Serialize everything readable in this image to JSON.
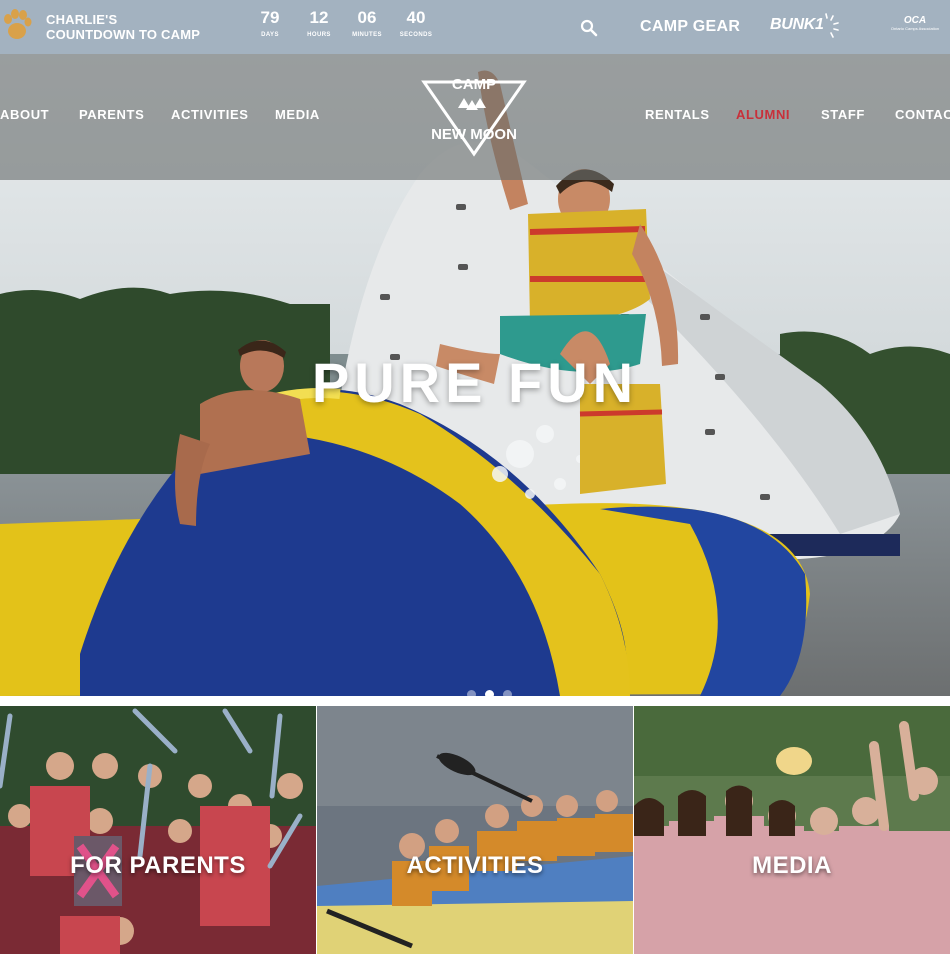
{
  "topbar": {
    "countdown_label_line1": "CHARLIE'S",
    "countdown_label_line2": "COUNTDOWN TO CAMP",
    "countdown": [
      {
        "value": "79",
        "unit": "DAYS"
      },
      {
        "value": "12",
        "unit": "HOURS"
      },
      {
        "value": "06",
        "unit": "MINUTES"
      },
      {
        "value": "40",
        "unit": "SECONDS"
      }
    ],
    "search_icon": "search-icon",
    "camp_gear": "CAMP GEAR",
    "bunk1": "BUNK1",
    "oca_logo": "OCA",
    "oca_sub": "Ontario Camps Association"
  },
  "nav": {
    "left": [
      "ABOUT",
      "PARENTS",
      "ACTIVITIES",
      "MEDIA"
    ],
    "right": [
      "RENTALS",
      "ALUMNI",
      "STAFF",
      "CONTACT"
    ],
    "active": "ALUMNI",
    "logo_line1": "CAMP",
    "logo_line2": "NEW MOON"
  },
  "hero": {
    "title": "PURE FUN",
    "slide_count": 3,
    "active_slide": 2
  },
  "tiles": [
    {
      "label": "FOR PARENTS"
    },
    {
      "label": "ACTIVITIES"
    },
    {
      "label": "MEDIA"
    }
  ],
  "colors": {
    "topbar_bg": "#a3b2c0",
    "nav_active": "#c8303a",
    "paw": "#d9a14a"
  }
}
